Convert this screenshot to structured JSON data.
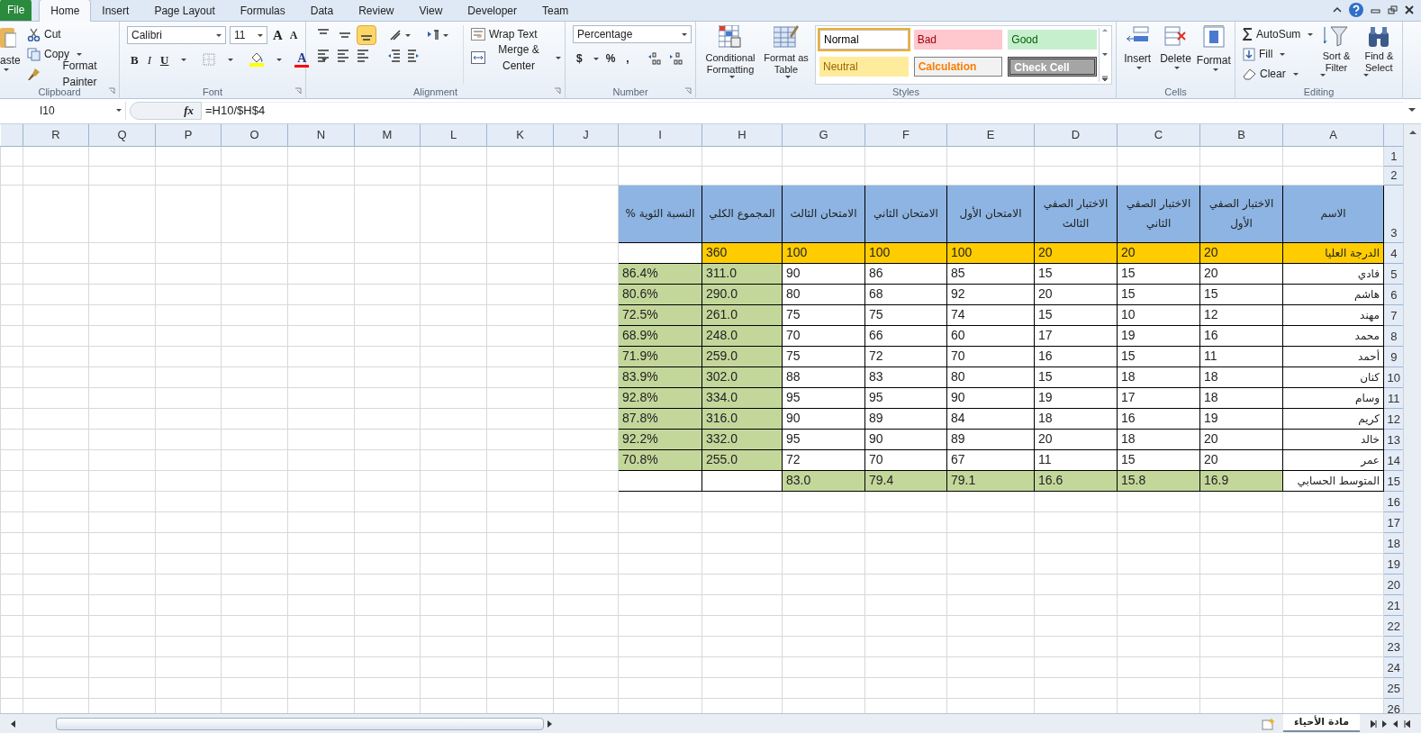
{
  "ribbon_tabs": [
    {
      "label": "File",
      "kind": "file",
      "selected": false
    },
    {
      "label": "Home",
      "kind": "tab",
      "selected": true
    },
    {
      "label": "Insert",
      "kind": "tab",
      "selected": false
    },
    {
      "label": "Page Layout",
      "kind": "tab",
      "selected": false
    },
    {
      "label": "Formulas",
      "kind": "tab",
      "selected": false
    },
    {
      "label": "Data",
      "kind": "tab",
      "selected": false
    },
    {
      "label": "Review",
      "kind": "tab",
      "selected": false
    },
    {
      "label": "View",
      "kind": "tab",
      "selected": false
    },
    {
      "label": "Developer",
      "kind": "tab",
      "selected": false
    },
    {
      "label": "Team",
      "kind": "tab",
      "selected": false
    }
  ],
  "clipboard": {
    "paste": "aste",
    "cut": "Cut",
    "copy": "Copy",
    "format_painter": "Format Painter",
    "label": "Clipboard"
  },
  "font": {
    "name": "Calibri",
    "size": "11",
    "grow": "A",
    "shrink": "A",
    "bold": "B",
    "italic": "I",
    "underline": "U",
    "color_button": "A",
    "label": "Font"
  },
  "alignment": {
    "vertical_align": [
      {
        "selected": false
      },
      {
        "selected": false
      },
      {
        "selected": true
      }
    ],
    "wrap_text": "Wrap Text",
    "merge_center": "Merge & Center",
    "label": "Alignment"
  },
  "number": {
    "format": "Percentage",
    "currency": "$",
    "percent": "%",
    "comma": ",",
    "label": "Number"
  },
  "styles": {
    "conditional": "Conditional Formatting",
    "format_table": "Format as Table",
    "label": "Styles",
    "cell_styles": [
      {
        "label": "Normal",
        "kind": "normal",
        "selected": true
      },
      {
        "label": "Bad",
        "kind": "bad",
        "selected": false
      },
      {
        "label": "Good",
        "kind": "good",
        "selected": false
      },
      {
        "label": "Neutral",
        "kind": "neutral",
        "selected": false
      },
      {
        "label": "Calculation",
        "kind": "calculation",
        "selected": false
      },
      {
        "label": "Check Cell",
        "kind": "check",
        "selected": false
      }
    ]
  },
  "cells": {
    "insert": "Insert",
    "delete": "Delete",
    "format": "Format",
    "label": "Cells"
  },
  "editing": {
    "autosum": "AutoSum",
    "fill": "Fill",
    "clear": "Clear",
    "sort": "Sort & Filter",
    "find": "Find & Select",
    "label": "Editing"
  },
  "formula_bar": {
    "name_box": "I10",
    "fx": "fx",
    "formula": "=H10/$H$4"
  },
  "sheet": {
    "columns": [
      "R",
      "Q",
      "P",
      "O",
      "N",
      "M",
      "L",
      "K",
      "J",
      "I",
      "H",
      "G",
      "F",
      "E",
      "D",
      "C",
      "B",
      "A"
    ],
    "rows": [
      "1",
      "2",
      "3",
      "4",
      "5",
      "6",
      "7",
      "8",
      "9",
      "10",
      "11",
      "12",
      "13",
      "14",
      "15",
      "16",
      "17",
      "18",
      "19",
      "20",
      "21",
      "22",
      "23",
      "24",
      "25",
      "26"
    ]
  },
  "table": {
    "header": [
      "الاسم",
      "الاختبار الصفي الأول",
      "الاختبار الصفي الثاني",
      "الاختبار الصفي الثالث",
      "الامتحان الأول",
      "الامتحان الثاني",
      "الامتحان الثالث",
      "المجموع الكلي",
      "النسبة الئوية %"
    ],
    "max_row": {
      "values": [
        "360",
        "100",
        "100",
        "100",
        "20",
        "20",
        "20"
      ],
      "label": "الدرجة العليا"
    },
    "students": [
      {
        "scores": [
          "86.4%",
          "311.0",
          "90",
          "86",
          "85",
          "15",
          "15",
          "20"
        ],
        "name": "فادي"
      },
      {
        "scores": [
          "80.6%",
          "290.0",
          "80",
          "68",
          "92",
          "20",
          "15",
          "15"
        ],
        "name": "هاشم"
      },
      {
        "scores": [
          "72.5%",
          "261.0",
          "75",
          "75",
          "74",
          "15",
          "10",
          "12"
        ],
        "name": "مهند"
      },
      {
        "scores": [
          "68.9%",
          "248.0",
          "70",
          "66",
          "60",
          "17",
          "19",
          "16"
        ],
        "name": "محمد"
      },
      {
        "scores": [
          "71.9%",
          "259.0",
          "75",
          "72",
          "70",
          "16",
          "15",
          "11"
        ],
        "name": "أحمد"
      },
      {
        "scores": [
          "83.9%",
          "302.0",
          "88",
          "83",
          "80",
          "15",
          "18",
          "18"
        ],
        "name": "كنان"
      },
      {
        "scores": [
          "92.8%",
          "334.0",
          "95",
          "95",
          "90",
          "19",
          "17",
          "18"
        ],
        "name": "وسام"
      },
      {
        "scores": [
          "87.8%",
          "316.0",
          "90",
          "89",
          "84",
          "18",
          "16",
          "19"
        ],
        "name": "كريم"
      },
      {
        "scores": [
          "92.2%",
          "332.0",
          "95",
          "90",
          "89",
          "20",
          "18",
          "20"
        ],
        "name": "خالد"
      },
      {
        "scores": [
          "70.8%",
          "255.0",
          "72",
          "70",
          "67",
          "11",
          "15",
          "20"
        ],
        "name": "عمر"
      }
    ],
    "average": {
      "values": [
        "83.0",
        "79.4",
        "79.1",
        "16.6",
        "15.8",
        "16.9"
      ],
      "label": "المتوسط الحسابي"
    }
  },
  "sheet_tabs": [
    {
      "label": "مادة الأحياء",
      "selected": true
    }
  ]
}
